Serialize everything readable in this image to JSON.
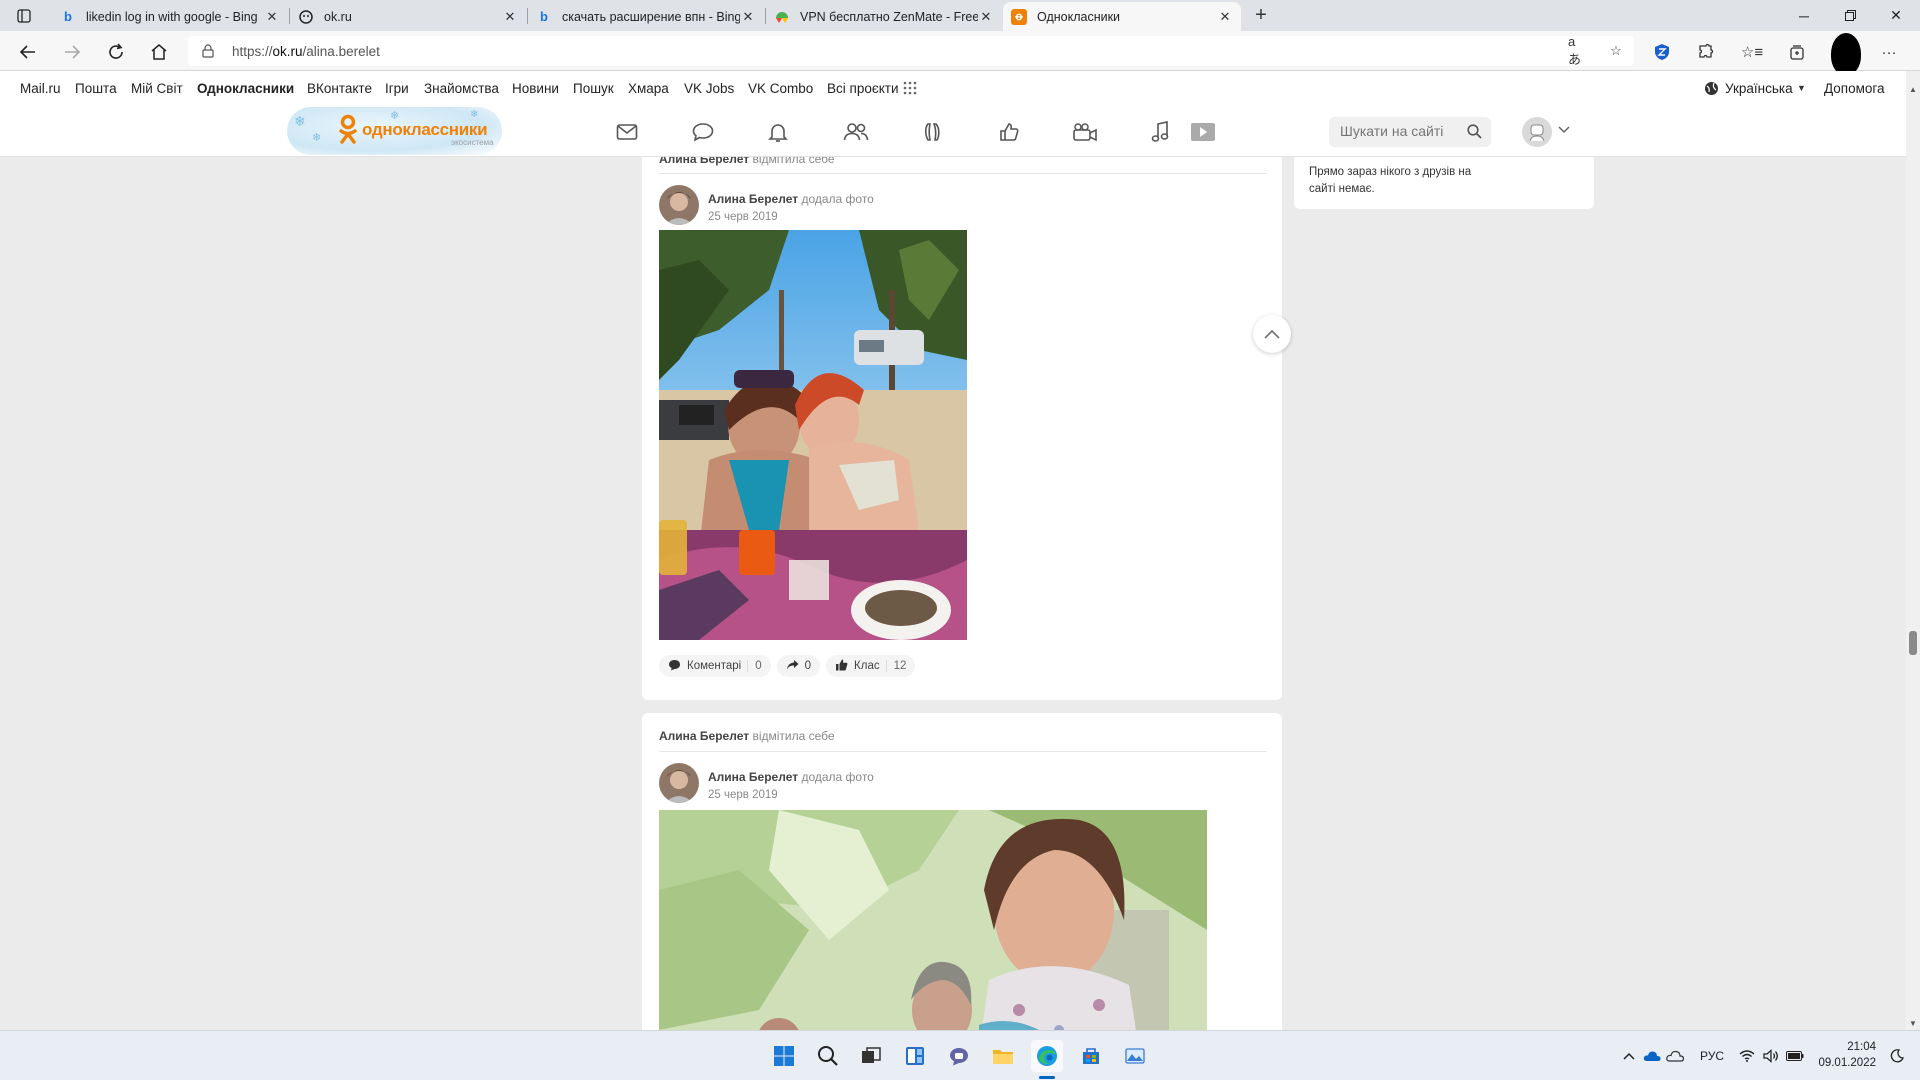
{
  "browser": {
    "tabs": [
      {
        "title": "likedin log in with google - Bing",
        "favicon": "bing-icon"
      },
      {
        "title": "ok.ru",
        "favicon": "ok-ghost-icon"
      },
      {
        "title": "скачать расширение впн - Bing",
        "favicon": "bing-icon"
      },
      {
        "title": "VPN бесплатно ZenMate - Free",
        "favicon": "zenmate-icon"
      },
      {
        "title": "Однокласники",
        "favicon": "ok-logo-icon",
        "active": true
      }
    ],
    "url_prefix": "https://",
    "url_host": "ok.ru",
    "url_path": "/alina.berelet"
  },
  "portal_nav": {
    "links": [
      "Mail.ru",
      "Пошта",
      "Мій Світ",
      "Однокласники",
      "ВКонтакте",
      "Ігри",
      "Знайомства",
      "Новини",
      "Пошук",
      "Хмара",
      "VK Jobs",
      "VK Combo",
      "Всі проєкти"
    ],
    "active": "Однокласники",
    "language": "Українська",
    "help": "Допомога"
  },
  "ok_header": {
    "logo_text": "одноклассники",
    "logo_sub": "экосистема",
    "search_placeholder": "Шукати на сайті",
    "nav_icons": [
      "messages-icon",
      "discussions-icon",
      "notifications-icon",
      "friends-icon",
      "guests-icon",
      "events-icon",
      "video-icon",
      "music-icon",
      "video-play-icon"
    ]
  },
  "feed": [
    {
      "mark_author": "Алина Берелет",
      "mark_action": "відмітила себе",
      "author": "Алина Берелет",
      "action": "додала фото",
      "date": "25 черв 2019",
      "actions": {
        "comments_label": "Коментарі",
        "comments_count": "0",
        "shares_count": "0",
        "likes_label": "Клас",
        "likes_count": "12"
      }
    },
    {
      "mark_author": "Алина Берелет",
      "mark_action": "відмітила себе",
      "author": "Алина Берелет",
      "action": "додала фото",
      "date": "25 черв 2019"
    }
  ],
  "sidebar": {
    "online_text": "Прямо зараз нікого з друзів на сайті немає."
  },
  "taskbar": {
    "lang": "РУС",
    "time": "21:04",
    "date": "09.01.2022"
  },
  "colors": {
    "ok_orange": "#ee8208",
    "page_bg": "#ebebeb",
    "taskbar_bg": "#e9eef5",
    "accent_blue": "#0067c0"
  }
}
